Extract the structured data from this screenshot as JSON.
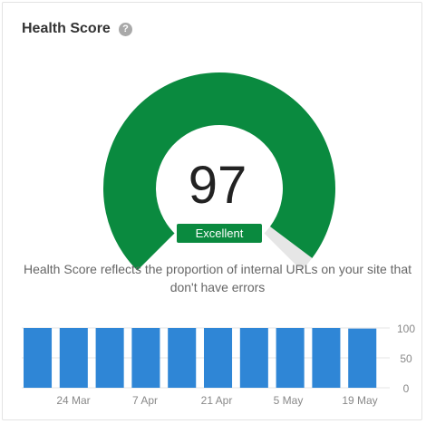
{
  "header": {
    "title": "Health Score",
    "help_icon": "question-circle-icon",
    "help_glyph": "?"
  },
  "gauge": {
    "score": "97",
    "score_value": 97,
    "max": 100,
    "rating": "Excellent",
    "fill_color": "#0a8a3f",
    "track_color": "#e6e6e6"
  },
  "description": "Health Score reflects the proportion of internal URLs on your site that don't have errors",
  "chart_data": {
    "type": "bar",
    "x_tick_labels": [
      "24 Mar",
      "7 Apr",
      "21 Apr",
      "5 May",
      "19 May"
    ],
    "values": [
      100,
      100,
      100,
      100,
      100,
      100,
      100,
      100,
      100,
      99
    ],
    "y_ticks": [
      100,
      50,
      0
    ],
    "ylim": [
      0,
      100
    ],
    "bar_color": "#2f86d6",
    "grid": true
  }
}
